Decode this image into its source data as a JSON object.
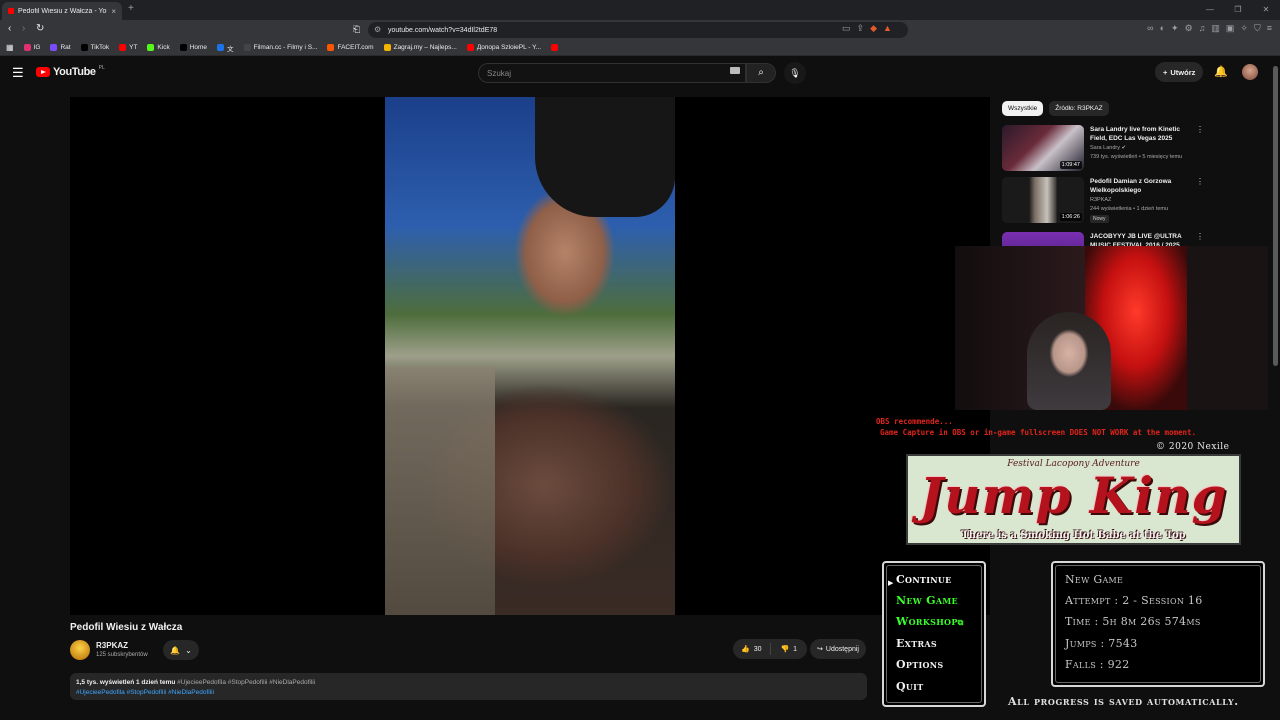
{
  "browser": {
    "tab_title": "Pedofil Wiesiu z Wałcza - You",
    "tab_close": "×",
    "new_tab": "+",
    "url": "youtube.com/watch?v=34dIl2tdE78",
    "bookmarks": [
      {
        "label": "IG",
        "color": "#e1306c"
      },
      {
        "label": "Rat",
        "color": "#7b4cff"
      },
      {
        "label": "TikTok",
        "color": "#000000"
      },
      {
        "label": "YT",
        "color": "#ff0000"
      },
      {
        "label": "Kick",
        "color": "#53fc18"
      },
      {
        "label": "Home",
        "color": "#000000"
      },
      {
        "label": "文",
        "color": "#1a73e8"
      },
      {
        "label": "Filman.cc - Filmy i S...",
        "color": "#444444"
      },
      {
        "label": "FACEIT.com",
        "color": "#ff5500"
      },
      {
        "label": "Zagraj.my – Najleps...",
        "color": "#f4b400"
      },
      {
        "label": "Допора SzloiePL - Y...",
        "color": "#ff0000"
      },
      {
        "label": "",
        "color": "#ff0000"
      }
    ]
  },
  "youtube": {
    "logo": "YouTube",
    "country": "PL",
    "search_placeholder": "Szukaj",
    "create_label": "Utwórz",
    "video": {
      "title": "Pedofil Wiesiu z Wałcza",
      "channel": "R3PKAZ",
      "subscribers": "125 subskrybentów",
      "likes": "30",
      "dislikes": "1",
      "share_label": "Udostępnij",
      "views_date": "1,5 tys. wyświetleń  1 dzień temu",
      "hashtags_line1": "#UjecieePedofila #StopPedofilii #NieDlaPedofilii",
      "hashtags_line2": "#UjecieePedofila #StopPedofilii #NieDlaPedofilii"
    },
    "chips": [
      "Wszystkie",
      "Źródło: R3PKAZ"
    ],
    "recommendations": [
      {
        "title": "Sara Landry live from Kinetic Field, EDC Las Vegas 2025",
        "channel": "Sara Landry",
        "meta": "739 tys. wyświetleń • 5 miesięcy temu",
        "duration": "1:09:47"
      },
      {
        "title": "Pedofil Damian z Gorzowa Wielkopolskiego",
        "channel": "R3PKAZ",
        "meta": "244 wyświetlenia • 1 dzień temu",
        "duration": "1:06:26",
        "badge": "Nowy"
      },
      {
        "title": "JACOBYYY JB LIVE @ULTRA MUSIC FESTIVAL 2016 / 2025",
        "channel": "",
        "meta": "",
        "duration": ""
      }
    ]
  },
  "game": {
    "obs_line1": "OBS recommende...                                                                                 ",
    "obs_line2": "Game Capture in OBS or in-game fullscreen DOES NOT WORK at the moment.",
    "copyright": "© 2020 Nexile",
    "logo_top": "Festival Lacopony Adventure",
    "logo_title": "Jump King",
    "logo_sub": "There is a Smoking Hot Babe at the Top",
    "menu": [
      "Continue",
      "New Game",
      "Workshop",
      "Extras",
      "Options",
      "Quit"
    ],
    "stats": {
      "header": "New Game",
      "attempt": "Attempt : 2  - Session 16",
      "time": "Time : 5h 8m 26s 574ms",
      "jumps": "Jumps : 7543",
      "falls": "Falls : 922"
    },
    "autosave": "All progress is saved automatically."
  }
}
